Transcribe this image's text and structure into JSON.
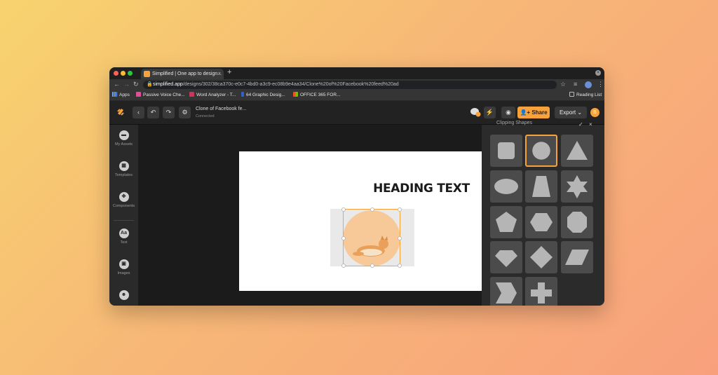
{
  "browser": {
    "tab_title": "Simplified | One app to design...",
    "tab_close": "×",
    "new_tab": "+",
    "url_host": "simplified.app",
    "url_path": "/designs/302/38ca370c-e0c7-4bd0-a3c9-ec08b9e4aa34/Clone%20of%20Facebook%20feed%20ad",
    "bookmarks": [
      "Apps",
      "Passive Voice Che...",
      "Word Analyzer - T...",
      "64 Graphic Desig...",
      "OFFICE 365 FOR..."
    ],
    "reading_list": "Reading List"
  },
  "app": {
    "doc_title": "Clone of Facebook fe...",
    "doc_status": "Connected",
    "share_label": "Share",
    "export_label": "Export",
    "avatar_initial": "B"
  },
  "sidebar": {
    "items": [
      {
        "label": "My Assets"
      },
      {
        "label": "Templates"
      },
      {
        "label": "Components"
      },
      {
        "label": "Text",
        "icon_text": "Aa"
      },
      {
        "label": "Images"
      }
    ]
  },
  "canvas": {
    "heading": "HEADING TEXT"
  },
  "panel": {
    "title": "Clipping Shapes",
    "shapes": [
      "square",
      "circle",
      "triangle",
      "ellipse",
      "trapezoid",
      "hexagram",
      "pentagon",
      "hexagon",
      "octagon",
      "diamond-gem",
      "rhombus",
      "parallelogram",
      "chevron",
      "cross"
    ],
    "active_shape": "circle"
  },
  "colors": {
    "accent": "#f7a23a"
  }
}
